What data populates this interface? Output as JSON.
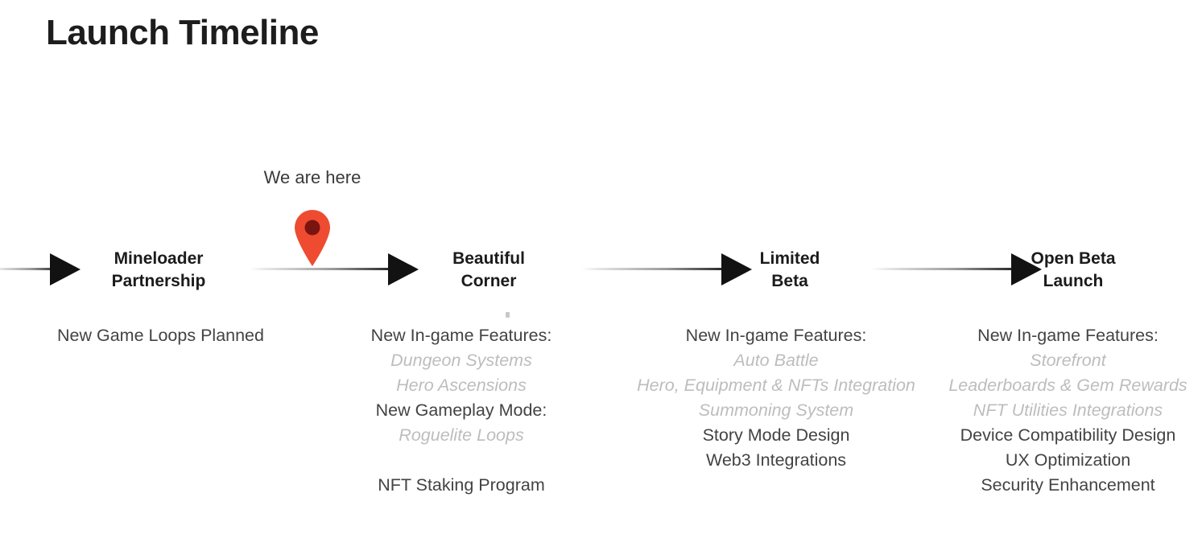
{
  "page": {
    "title": "Launch Timeline",
    "background_color": "#ffffff",
    "text_color": "#1b1b1b",
    "muted_text_color": "#bdbdbd",
    "accent_color": "#ee4b31"
  },
  "marker": {
    "label": "We are here",
    "icon": "map-pin-icon",
    "pin_color": "#ee4b31",
    "pin_dot_color": "#7a1410",
    "after_milestone_index": 0
  },
  "milestones": [
    {
      "label_line1": "Mineloader",
      "label_line2": "Partnership",
      "details": [
        {
          "text": "New Game Loops Planned",
          "style": "normal"
        }
      ]
    },
    {
      "label_line1": "Beautiful",
      "label_line2": "Corner",
      "details": [
        {
          "text": "New In-game Features:",
          "style": "normal"
        },
        {
          "text": "Dungeon Systems",
          "style": "sub"
        },
        {
          "text": "Hero Ascensions",
          "style": "sub"
        },
        {
          "text": "New Gameplay Mode:",
          "style": "normal"
        },
        {
          "text": "Roguelite Loops",
          "style": "sub"
        },
        {
          "text": "",
          "style": "spacer"
        },
        {
          "text": "NFT Staking Program",
          "style": "normal"
        }
      ]
    },
    {
      "label_line1": "Limited",
      "label_line2": "Beta",
      "details": [
        {
          "text": "New In-game Features:",
          "style": "normal"
        },
        {
          "text": "Auto Battle",
          "style": "sub"
        },
        {
          "text": "Hero, Equipment & NFTs Integration",
          "style": "sub"
        },
        {
          "text": "Summoning System",
          "style": "sub"
        },
        {
          "text": "Story Mode Design",
          "style": "normal"
        },
        {
          "text": "Web3 Integrations",
          "style": "normal"
        }
      ]
    },
    {
      "label_line1": "Open Beta",
      "label_line2": "Launch",
      "details": [
        {
          "text": "New In-game Features:",
          "style": "normal"
        },
        {
          "text": "Storefront",
          "style": "sub"
        },
        {
          "text": "Leaderboards & Gem Rewards",
          "style": "sub"
        },
        {
          "text": "NFT Utilities Integrations",
          "style": "sub"
        },
        {
          "text": "Device Compatibility Design",
          "style": "normal"
        },
        {
          "text": "UX Optimization",
          "style": "normal"
        },
        {
          "text": "Security Enhancement",
          "style": "normal"
        }
      ]
    }
  ]
}
